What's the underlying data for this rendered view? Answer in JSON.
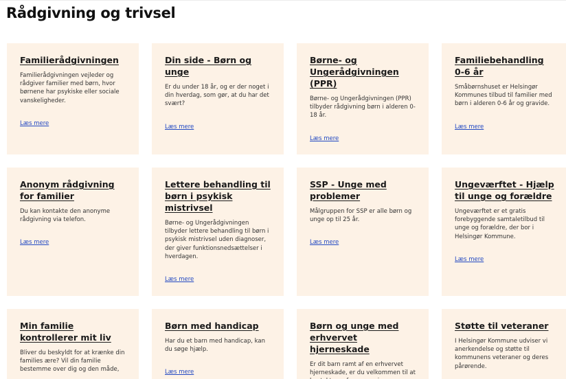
{
  "page": {
    "title": "Rådgivning og trivsel"
  },
  "cards": [
    {
      "title": "Familierådgivningen",
      "desc": "Familierådgivningen vejleder og rådgiver familier med børn, hvor børnene har psykiske eller sociale vanskeligheder.",
      "link": "Læs mere"
    },
    {
      "title": "Din side - Børn og unge",
      "desc": "Er du under 18 år, og er der noget i din hverdag, som gør, at du har det svært?",
      "link": "Læs mere"
    },
    {
      "title": "Børne- og Ungerådgivningen (PPR)",
      "desc": "Børne- og Ungerådgivningen (PPR) tilbyder rådgivning børn i alderen 0-18 år.",
      "link": "Læs mere"
    },
    {
      "title": "Familiebehandling 0-6 år",
      "desc": "Småbørnshuset er Helsingør Kommunes tilbud til familier med børn i alderen 0-6 år og gravide.",
      "link": "Læs mere"
    },
    {
      "title": "Anonym rådgivning for familier",
      "desc": "Du kan kontakte den anonyme rådgivning via telefon.",
      "link": "Læs mere"
    },
    {
      "title": "Lettere behandling til børn i psykisk mistrivsel",
      "desc": "Børne- og Ungerådgivningen tilbyder lettere behandling til børn i psykisk mistrivsel uden diagnoser, der giver funktionsnedsættelser i hverdagen.",
      "link": "Læs mere"
    },
    {
      "title": "SSP - Unge med problemer",
      "desc": "Målgruppen for SSP er alle børn og unge op til 25 år.",
      "link": "Læs mere"
    },
    {
      "title": "Ungeværftet - Hjælp til unge og forældre",
      "desc": "Ungeværftet er et gratis forebyggende samtaletilbud til unge og forældre, der bor i Helsingør Kommune.",
      "link": "Læs mere"
    },
    {
      "title": "Min familie kontrollerer mit liv",
      "desc": "Bliver du beskyldt for at krænke din families ære? Vil din familie bestemme over dig og den måde,",
      "link": ""
    },
    {
      "title": "Børn med handicap",
      "desc": "Har du et barn med handicap, kan du søge hjælp.",
      "link": "Læs mere"
    },
    {
      "title": "Børn og unge med erhvervet hjerneskade",
      "desc": "Er dit barn ramt af en erhvervet hjerneskade, er du velkommen til at kontakte en fagperson i vores",
      "link": ""
    },
    {
      "title": "Støtte til veteraner",
      "desc": "I Helsingør Kommune udviser vi anerkendelse og støtte til kommunens veteraner og deres pårørende.",
      "link": ""
    }
  ]
}
